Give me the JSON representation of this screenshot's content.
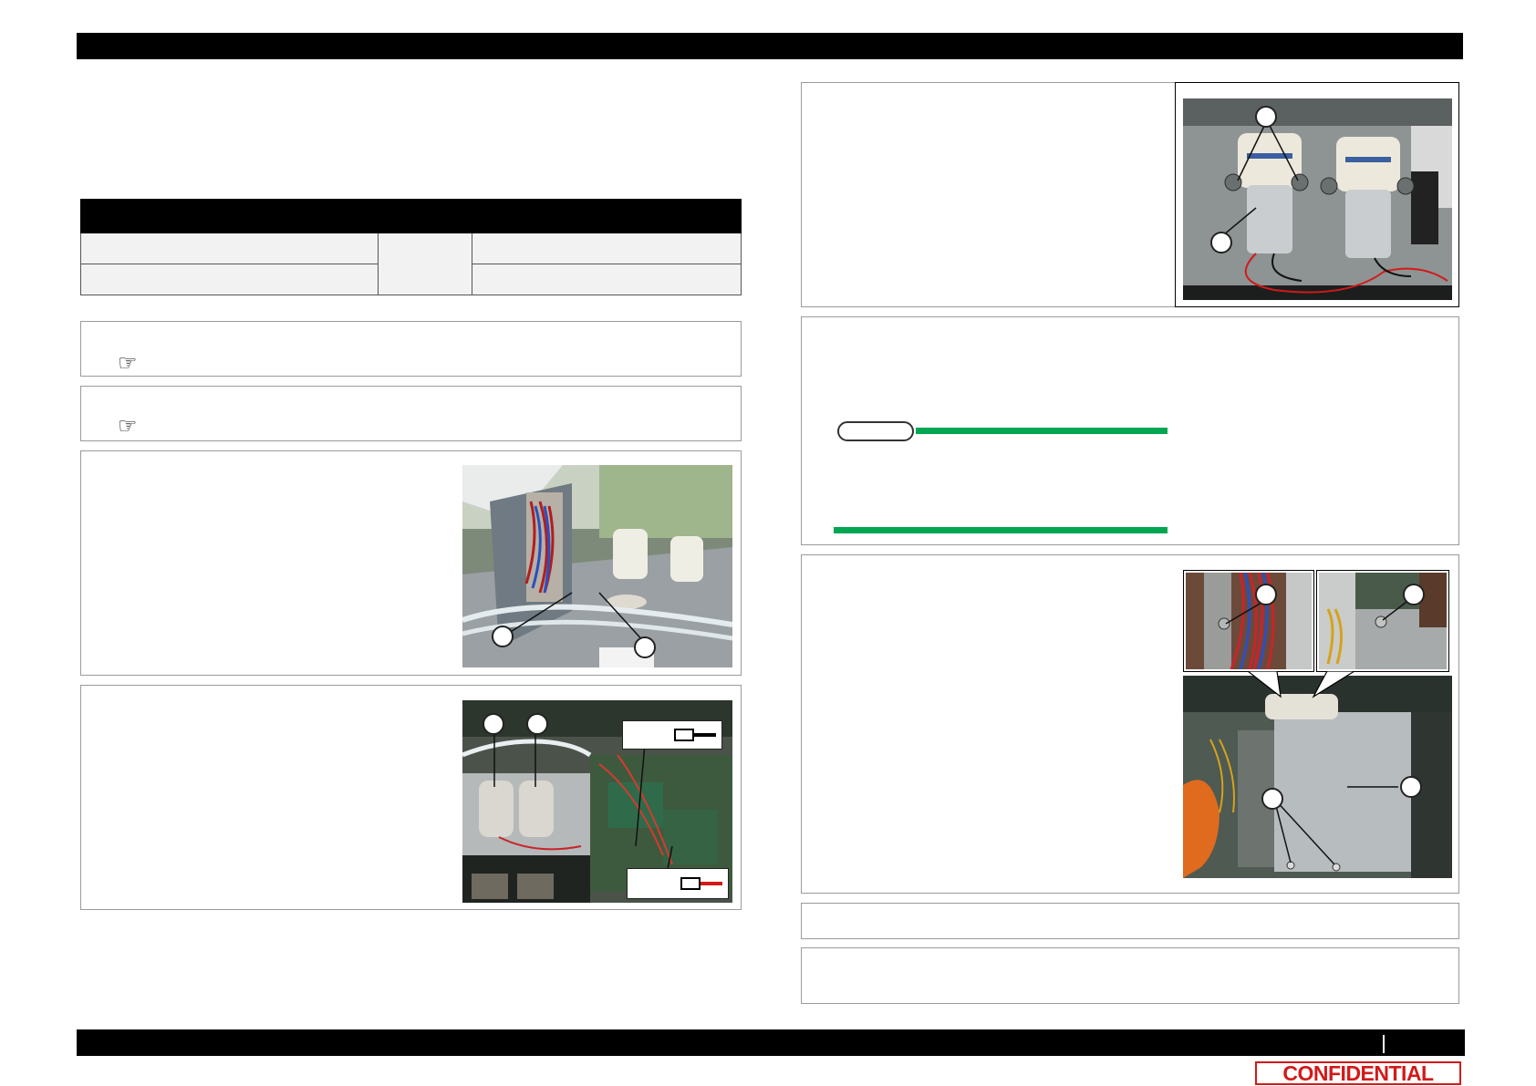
{
  "header": {
    "title": ""
  },
  "footer": {
    "page": ""
  },
  "confidential_label": "CONFIDENTIAL",
  "colors": {
    "note_green": "#00a651",
    "confidential_red": "#d21a1a"
  },
  "icons": [
    "hand-pointer-icon",
    "hand-pointer-icon"
  ]
}
